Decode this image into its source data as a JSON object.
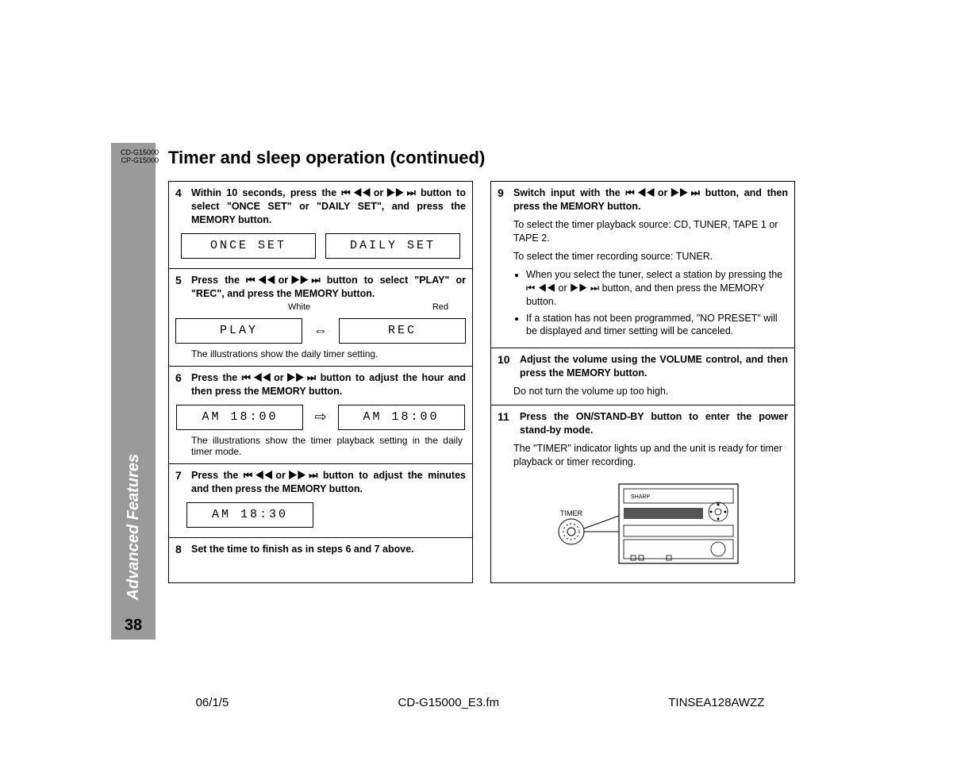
{
  "model": {
    "line1": "CD-G15000",
    "line2": "CP-G15000"
  },
  "title": "Timer and sleep operation (continued)",
  "sidebar": {
    "section": "Advanced Features",
    "page": "38"
  },
  "icons": {
    "skip": "⏮ ◀◀ or ▶▶ ⏭"
  },
  "steps": {
    "s4": {
      "num": "4",
      "text_a": "Within 10 seconds, press the ",
      "text_b": " button to select \"ONCE SET\" or \"DAILY SET\", and press the MEMORY button.",
      "lcd1": "ONCE  SET",
      "lcd2": "DAILY  SET"
    },
    "s5": {
      "num": "5",
      "text_a": "Press the ",
      "text_b": " button to select \"PLAY\" or \"REC\", and press the MEMORY button.",
      "label_white": "White",
      "label_red": "Red",
      "lcd1": "PLAY",
      "lcd2": "REC",
      "caption": "The illustrations show the daily timer setting."
    },
    "s6": {
      "num": "6",
      "text_a": "Press the ",
      "text_b": " button to adjust the hour and then press the MEMORY button.",
      "lcd1": "AM  18:00",
      "lcd2": "AM   18:00",
      "caption": "The illustrations show the timer playback setting in the daily timer mode."
    },
    "s7": {
      "num": "7",
      "text_a": "Press the ",
      "text_b": " button to adjust the minutes and then press the MEMORY button.",
      "lcd1": "AM   18:30"
    },
    "s8": {
      "num": "8",
      "text": "Set the time to finish as in steps 6 and 7 above."
    },
    "s9": {
      "num": "9",
      "text_a": "Switch input with the ",
      "text_b": " button, and then press the MEMORY button.",
      "p1": "To select the timer playback source: CD, TUNER, TAPE 1 or TAPE 2.",
      "p2": "To select the timer recording source: TUNER.",
      "b1a": "When you select the tuner, select a station by pressing the ",
      "b1b": " button, and then press the MEMORY button.",
      "b2": "If a station has not been programmed, \"NO PRESET\" will be displayed and timer setting will be canceled."
    },
    "s10": {
      "num": "10",
      "text": "Adjust the volume using the VOLUME control, and then press the MEMORY button.",
      "p1": "Do not turn the volume up too high."
    },
    "s11": {
      "num": "11",
      "text": "Press the ON/STAND-BY button to enter the power stand-by mode.",
      "p1": "The \"TIMER\" indicator lights up and the unit is ready for timer playback or timer recording.",
      "timer_label": "TIMER"
    }
  },
  "footer": {
    "date": "06/1/5",
    "file": "CD-G15000_E3.fm",
    "code": "TINSEA128AWZZ"
  }
}
